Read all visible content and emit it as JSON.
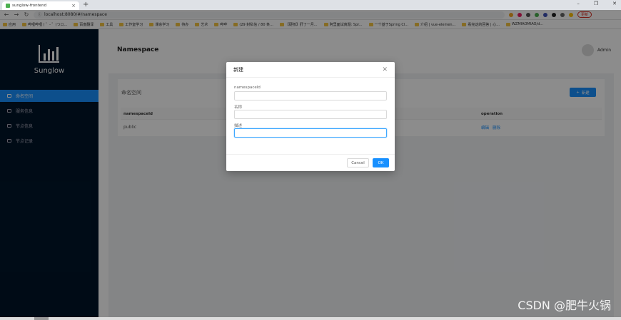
{
  "browser": {
    "tab_title": "sunglow-frontend",
    "url": "localhost:8080/#/namespace",
    "update_label": "更新",
    "bookmarks": [
      "应用",
      "哔哩哔哩 ( ゜- ゜)つロ...",
      "百度翻译",
      "工具",
      "工作室学习",
      "课余学习",
      "待办",
      "艺术",
      "哔哔",
      "(29 封私信 / 80 条...",
      "【硬核】肝了一月...",
      "阿里面试真题: Spr...",
      "一个基于Spring Cl...",
      "介绍 | vue-elemen...",
      "看完这的回答 | 心...",
      "WZMIAOMIAO/d..."
    ]
  },
  "sidebar": {
    "app_name": "Sunglow",
    "items": [
      {
        "label": "命名空间",
        "selected": true
      },
      {
        "label": "服务信息",
        "selected": false
      },
      {
        "label": "节点信息",
        "selected": false
      },
      {
        "label": "节点记录",
        "selected": false
      }
    ]
  },
  "header": {
    "title": "Namespace",
    "user": "Admin"
  },
  "content": {
    "card_title": "命名空间",
    "add_button": "新建",
    "columns": [
      "namespaceId",
      "operation"
    ],
    "rows": [
      {
        "namespaceId": "public",
        "ops": [
          "编辑",
          "删除"
        ]
      }
    ]
  },
  "modal": {
    "title": "新建",
    "fields": [
      {
        "label": "namespaceId",
        "value": ""
      },
      {
        "label": "名称",
        "value": ""
      },
      {
        "label": "描述",
        "value": ""
      }
    ],
    "cancel": "Cancel",
    "ok": "OK"
  },
  "watermark": "CSDN @肥牛火锅",
  "colors": {
    "primary": "#1890ff",
    "sidebar": "#001529"
  }
}
